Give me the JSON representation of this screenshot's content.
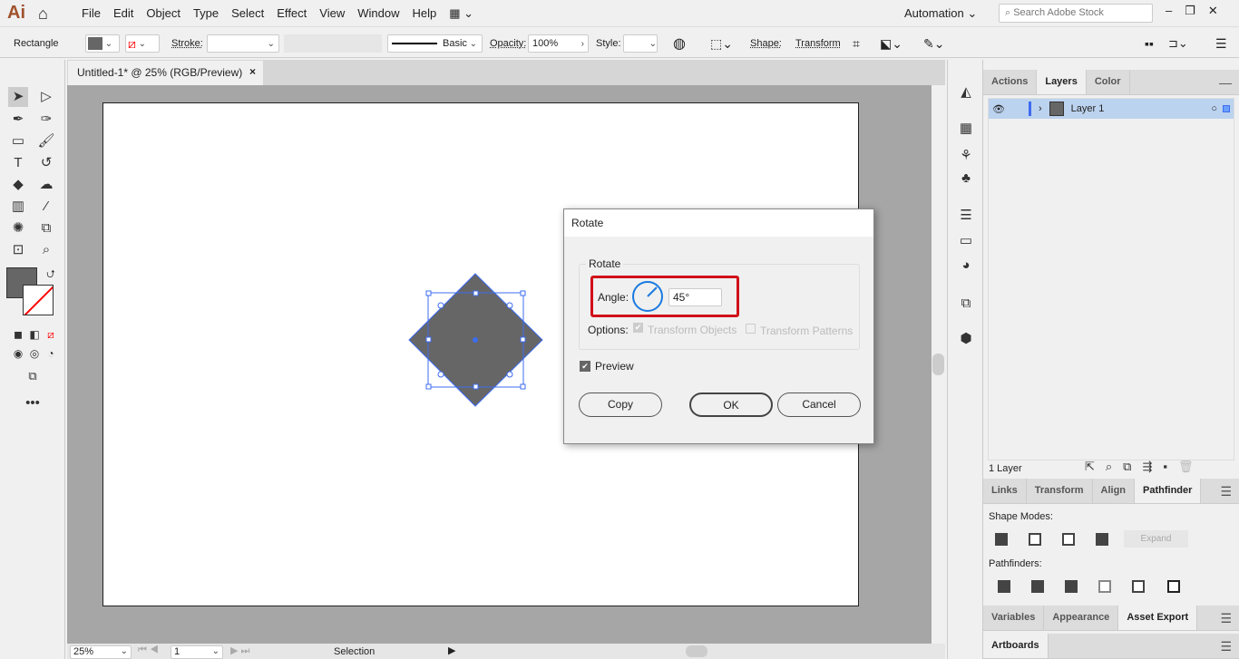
{
  "app": {
    "logo": "Ai",
    "menus": [
      "File",
      "Edit",
      "Object",
      "Type",
      "Select",
      "Effect",
      "View",
      "Window",
      "Help"
    ],
    "workspace": "Automation",
    "search_placeholder": "Search Adobe Stock"
  },
  "control": {
    "object_type": "Rectangle",
    "fill_color": "#666666",
    "stroke_label": "Stroke:",
    "brush": "Basic",
    "opacity_label": "Opacity:",
    "opacity": "100%",
    "style_label": "Style:",
    "shape_label": "Shape:",
    "transform_label": "Transform"
  },
  "document": {
    "tab": "Untitled-1* @ 25% (RGB/Preview)",
    "close": "×"
  },
  "status": {
    "zoom": "25%",
    "artboard": "1",
    "tool": "Selection"
  },
  "dialog": {
    "title": "Rotate",
    "group": "Rotate",
    "angle_label": "Angle:",
    "angle": "45°",
    "options_label": "Options:",
    "transform_objects": "Transform Objects",
    "transform_patterns": "Transform Patterns",
    "preview": "Preview",
    "copy": "Copy",
    "ok": "OK",
    "cancel": "Cancel",
    "highlight_color": "#d0101a"
  },
  "layers": {
    "tabs": [
      "Actions",
      "Layers",
      "Color"
    ],
    "active": "Layers",
    "items": [
      {
        "name": "Layer 1"
      }
    ],
    "count": "1 Layer"
  },
  "pathfinder": {
    "tabs": [
      "Links",
      "Transform",
      "Align",
      "Pathfinder"
    ],
    "shape_modes": "Shape Modes:",
    "expand": "Expand",
    "pathfinders": "Pathfinders:"
  },
  "bottom_tabs": [
    "Variables",
    "Appearance",
    "Asset Export"
  ],
  "artboards_tab": "Artboards",
  "shape": {
    "fill": "#666666",
    "selection_color": "#3d6cf0",
    "rotation_deg": 45
  }
}
